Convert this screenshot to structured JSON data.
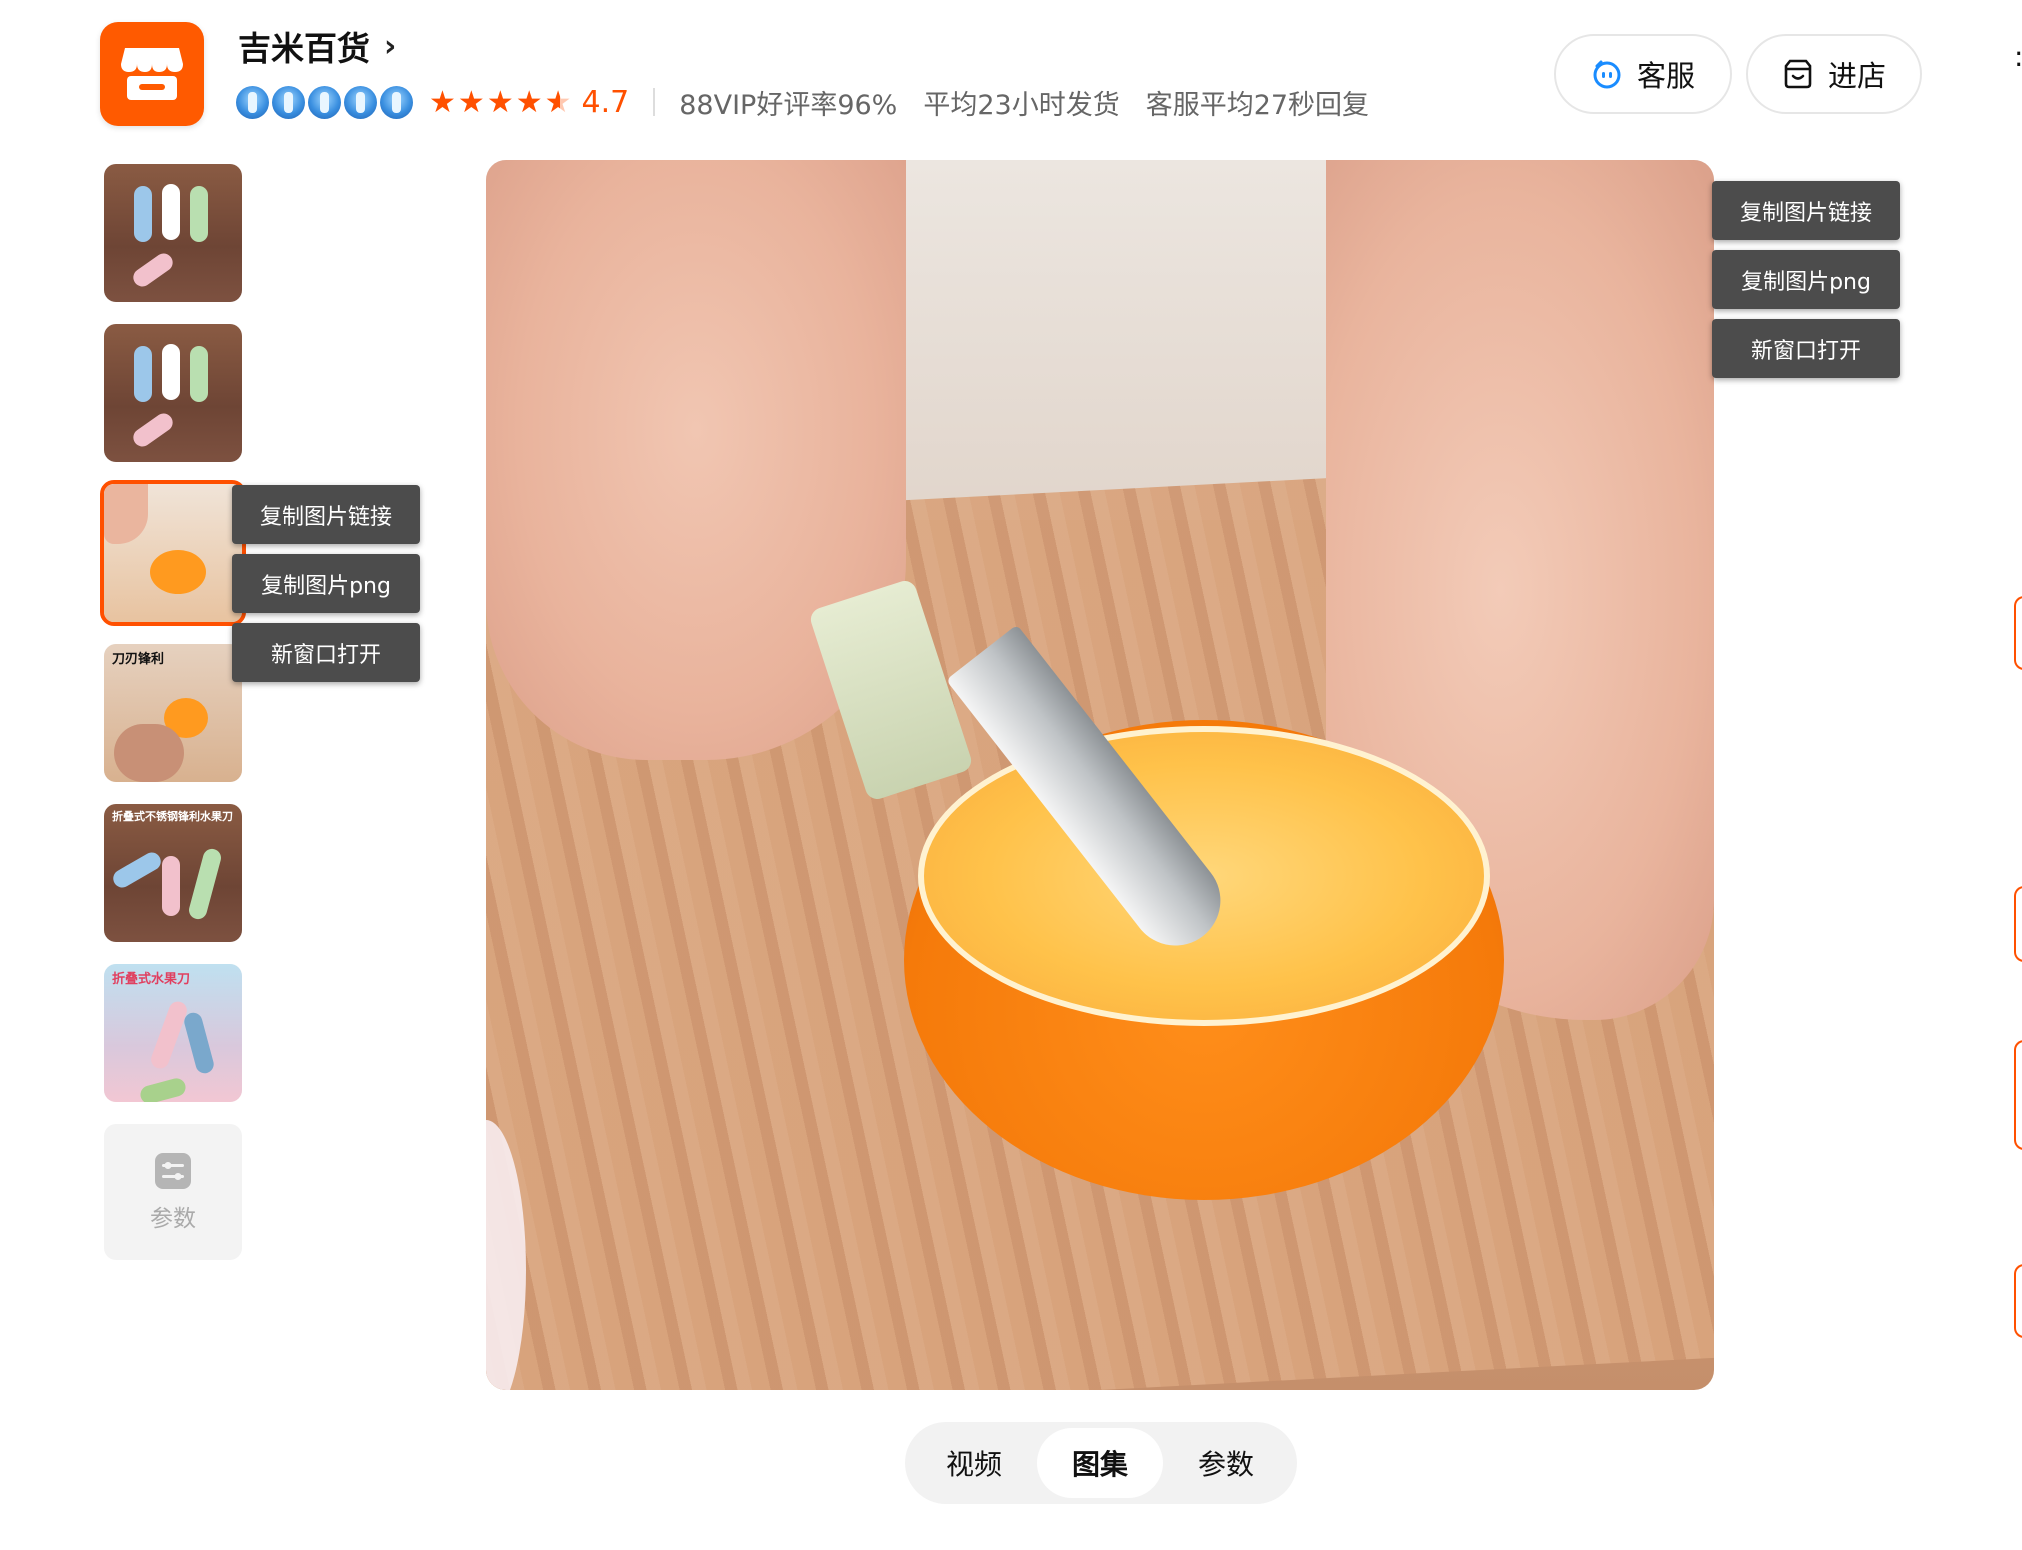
{
  "shop": {
    "name": "吉米百货",
    "rating": "4.7",
    "vip_rate": "88VIP好评率96%",
    "shipping": "平均23小时发货",
    "service_reply": "客服平均27秒回复",
    "crown_count": 5,
    "stars_value": 4.7
  },
  "header_buttons": {
    "service": "客服",
    "store": "进店"
  },
  "thumbnails": [
    {
      "caption": ""
    },
    {
      "caption": ""
    },
    {
      "caption": ""
    },
    {
      "caption": "刀刃锋利"
    },
    {
      "caption": "折叠式不锈钢锋利水果刀"
    },
    {
      "caption": "折叠式水果刀"
    }
  ],
  "params_thumb": {
    "label": "参数"
  },
  "context_menu": {
    "copy_link": "复制图片链接",
    "copy_png": "复制图片png",
    "open_new": "新窗口打开"
  },
  "gallery_tabs": [
    {
      "label": "视频",
      "active": false
    },
    {
      "label": "图集",
      "active": true
    },
    {
      "label": "参数",
      "active": false
    }
  ],
  "colors": {
    "accent": "#ff5000",
    "menu_bg": "#4c4c4c"
  }
}
